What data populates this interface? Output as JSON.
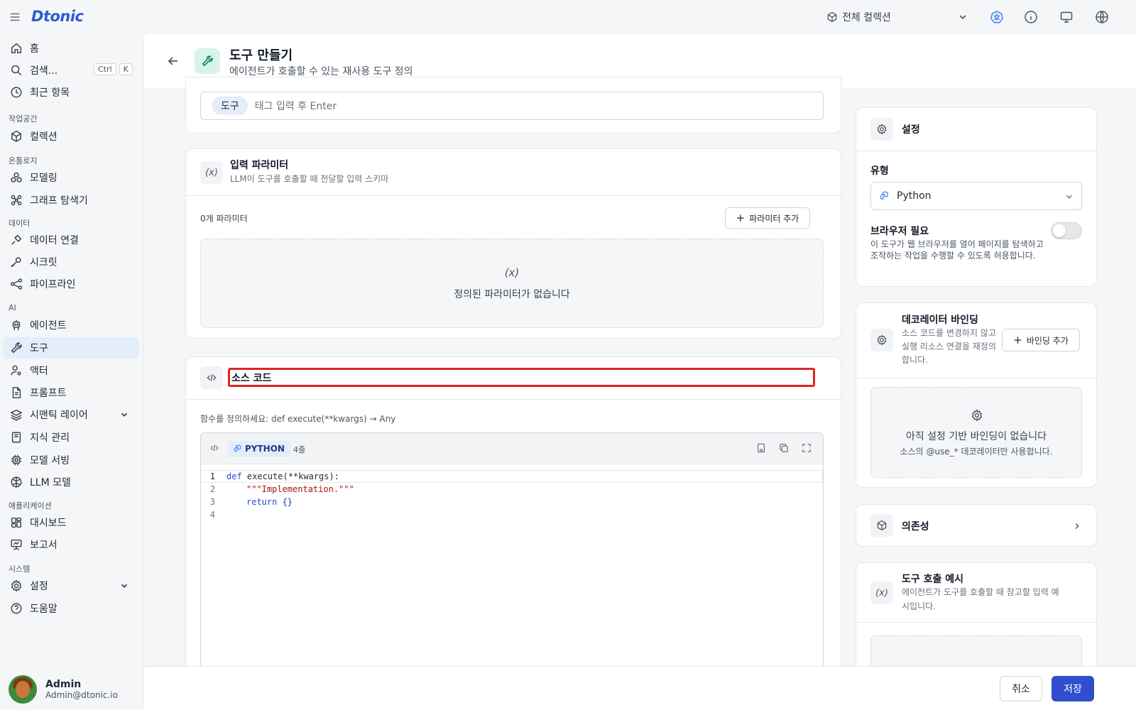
{
  "app": {
    "logo": "Dtonic"
  },
  "topbar": {
    "collection": "전체 컬렉션"
  },
  "sidebar": {
    "home": "홈",
    "search": "검색...",
    "kbd_ctrl": "Ctrl",
    "kbd_k": "K",
    "recent": "최근 항목",
    "sections": {
      "workspace": "작업공간",
      "ontology": "온톨로지",
      "data": "데이터",
      "ai": "AI",
      "apps": "애플리케이션",
      "system": "시스템"
    },
    "items": {
      "collections": "컬렉션",
      "modeling": "모델링",
      "graph": "그래프 탐색기",
      "data_conn": "데이터 연결",
      "secret": "시크릿",
      "pipeline": "파이프라인",
      "agent": "에이전트",
      "tool": "도구",
      "actor": "액터",
      "prompt": "프롬프트",
      "semantic": "시맨틱 레이어",
      "knowledge": "지식 관리",
      "serving": "모델 서빙",
      "llm": "LLM 모델",
      "dashboard": "대시보드",
      "report": "보고서",
      "settings": "설정",
      "help": "도움말"
    },
    "user": {
      "name": "Admin",
      "email": "Admin@dtonic.io"
    }
  },
  "header": {
    "title": "도구 만들기",
    "subtitle": "에이전트가 호출할 수 있는 재사용 도구 정의"
  },
  "tags": {
    "chip": "도구",
    "placeholder": "태그 입력 후 Enter"
  },
  "params": {
    "title": "입력 파라미터",
    "subtitle": "LLM이 도구를 호출할 때 전달할 입력 스키마",
    "icon_text": "(x)",
    "count": "0개 파라미터",
    "add": "파라미터 추가",
    "empty": "정의된 파라미터가 없습니다"
  },
  "source": {
    "title": "소스 코드",
    "hint": "함수를 정의하세요: def execute(**kwargs) → Any",
    "lang": "PYTHON",
    "lines_label": "4줄",
    "line_numbers": [
      "1",
      "2",
      "3",
      "4"
    ],
    "code": {
      "l1_kw": "def",
      "l1_rest": " execute(**kwargs):",
      "l2": "\"\"\"Implementation.\"\"\"",
      "l3_kw": "return",
      "l3_rest": " {}"
    }
  },
  "settings": {
    "title": "설정",
    "type_label": "유형",
    "type_value": "Python",
    "browser_label": "브라우저 필요",
    "browser_desc": "이 도구가 웹 브라우저를 열어 페이지를 탐색하고 조작하는 작업을 수행할 수 있도록 허용합니다.",
    "browser_enabled": false
  },
  "decorator": {
    "title": "데코레이터 바인딩",
    "desc": "소스 코드를 변경하지 않고 실행 리소스 연결을 재정의합니다.",
    "add": "바인딩 추가",
    "empty_title": "아직 설정 기반 바인딩이 없습니다",
    "empty_sub": "소스의 @use_* 데코레이터만 사용합니다."
  },
  "deps": {
    "title": "의존성"
  },
  "example": {
    "title": "도구 호출 예시",
    "desc": "에이전트가 도구를 호출할 때 참고할 입력 예시입니다.",
    "icon_text": "(x)"
  },
  "footer": {
    "cancel": "취소",
    "save": "저장"
  },
  "colors": {
    "primary": "#2f4fd0",
    "accent": "#2d5bd0",
    "active_nav": "#e4edfa",
    "highlight": "#e02424"
  }
}
